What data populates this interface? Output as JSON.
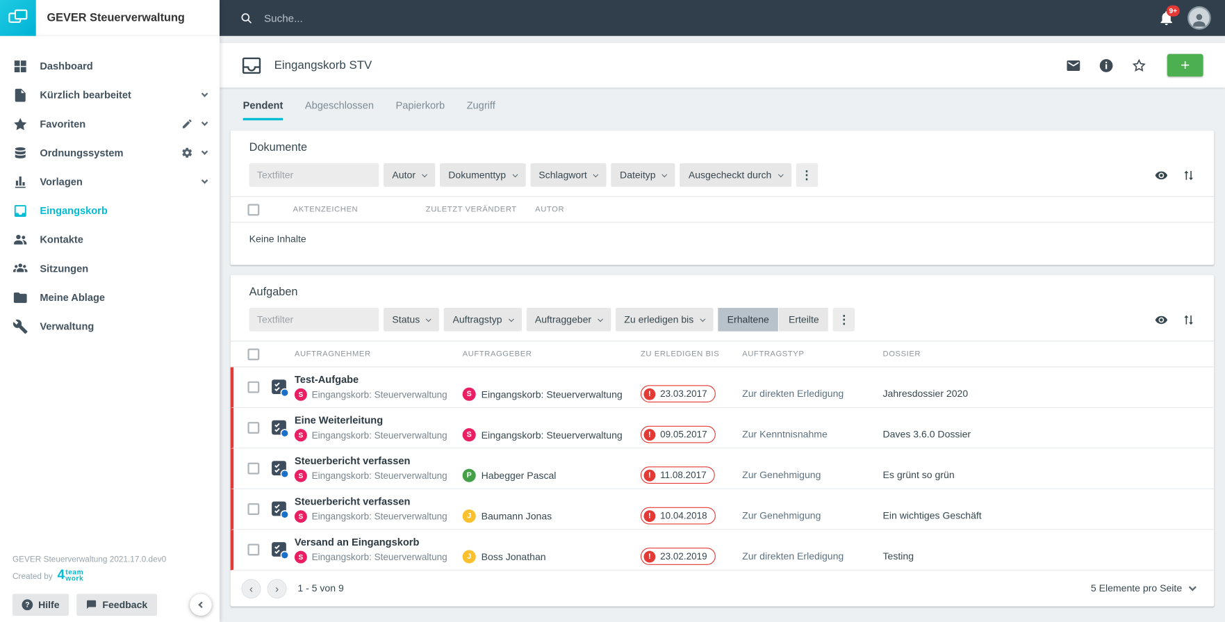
{
  "colors": {
    "accent": "#00bcd4",
    "topbar_bg": "#313e4c",
    "add_button": "#4caf50",
    "danger": "#e53935",
    "task_icon": "#3d4d5d",
    "task_dot": "#1a6fc9"
  },
  "app": {
    "name": "GEVER Steuerverwaltung",
    "version_line": "GEVER Steuerverwaltung 2021.17.0.dev0",
    "created_by_label": "Created by",
    "brand": {
      "mark": "4",
      "top": "team",
      "bottom": "work"
    }
  },
  "topbar": {
    "search_placeholder": "Suche...",
    "notification_badge": "9+"
  },
  "sidebar": {
    "items": [
      {
        "label": "Dashboard",
        "icon": "dashboard",
        "active": false
      },
      {
        "label": "Kürzlich bearbeitet",
        "icon": "document-edit",
        "chevron": true,
        "active": false
      },
      {
        "label": "Favoriten",
        "icon": "star",
        "edit": true,
        "chevron": true,
        "active": false
      },
      {
        "label": "Ordnungssystem",
        "icon": "layers",
        "gear": true,
        "chevron": true,
        "active": false
      },
      {
        "label": "Vorlagen",
        "icon": "templates",
        "chevron": true,
        "active": false
      },
      {
        "label": "Eingangskorb",
        "icon": "inbox",
        "active": true
      },
      {
        "label": "Kontakte",
        "icon": "contacts",
        "active": false
      },
      {
        "label": "Sitzungen",
        "icon": "meetings",
        "active": false
      },
      {
        "label": "Meine Ablage",
        "icon": "folder-user",
        "active": false
      },
      {
        "label": "Verwaltung",
        "icon": "wrench",
        "active": false
      }
    ],
    "help_label": "Hilfe",
    "feedback_label": "Feedback"
  },
  "header": {
    "title": "Eingangskorb STV",
    "add_label": "+"
  },
  "tabs": [
    {
      "label": "Pendent",
      "active": true
    },
    {
      "label": "Abgeschlossen",
      "active": false
    },
    {
      "label": "Papierkorb",
      "active": false
    },
    {
      "label": "Zugriff",
      "active": false
    }
  ],
  "dokumente": {
    "title": "Dokumente",
    "textfilter_placeholder": "Textfilter",
    "filters": [
      "Autor",
      "Dokumenttyp",
      "Schlagwort",
      "Dateityp",
      "Ausgecheckt durch"
    ],
    "columns": [
      "AKTENZEICHEN",
      "ZULETZT VERÄNDERT",
      "AUTOR"
    ],
    "empty_label": "Keine Inhalte"
  },
  "aufgaben": {
    "title": "Aufgaben",
    "textfilter_placeholder": "Textfilter",
    "filters": [
      "Status",
      "Auftragstyp",
      "Auftraggeber",
      "Zu erledigen bis"
    ],
    "toggle": [
      {
        "label": "Erhaltene",
        "active": true
      },
      {
        "label": "Erteilte",
        "active": false
      }
    ],
    "columns": [
      "AUFTRAGNEHMER",
      "AUFTRAGGEBER",
      "ZU ERLEDIGEN BIS",
      "AUFTRAGSTYP",
      "DOSSIER"
    ],
    "rows": [
      {
        "title": "Test-Aufgabe",
        "nehmer": {
          "name": "Eingangskorb: Steuerverwaltung",
          "initial": "S",
          "color": "#e91e63"
        },
        "geber": {
          "name": "Eingangskorb: Steuerverwaltung",
          "initial": "S",
          "color": "#e91e63"
        },
        "due": "23.03.2017",
        "typ": "Zur direkten Erledigung",
        "dossier": "Jahresdossier 2020"
      },
      {
        "title": "Eine Weiterleitung",
        "nehmer": {
          "name": "Eingangskorb: Steuerverwaltung",
          "initial": "S",
          "color": "#e91e63"
        },
        "geber": {
          "name": "Eingangskorb: Steuerverwaltung",
          "initial": "S",
          "color": "#e91e63"
        },
        "due": "09.05.2017",
        "typ": "Zur Kenntnisnahme",
        "dossier": "Daves 3.6.0 Dossier"
      },
      {
        "title": "Steuerbericht verfassen",
        "nehmer": {
          "name": "Eingangskorb: Steuerverwaltung",
          "initial": "S",
          "color": "#e91e63"
        },
        "geber": {
          "name": "Habegger Pascal",
          "initial": "P",
          "color": "#43a047"
        },
        "due": "11.08.2017",
        "typ": "Zur Genehmigung",
        "dossier": "Es grünt so grün"
      },
      {
        "title": "Steuerbericht verfassen",
        "nehmer": {
          "name": "Eingangskorb: Steuerverwaltung",
          "initial": "S",
          "color": "#e91e63"
        },
        "geber": {
          "name": "Baumann Jonas",
          "initial": "J",
          "color": "#fbc02d"
        },
        "due": "10.04.2018",
        "typ": "Zur Genehmigung",
        "dossier": "Ein wichtiges Geschäft"
      },
      {
        "title": "Versand an Eingangskorb",
        "nehmer": {
          "name": "Eingangskorb: Steuerverwaltung",
          "initial": "S",
          "color": "#e91e63"
        },
        "geber": {
          "name": "Boss Jonathan",
          "initial": "J",
          "color": "#fbc02d"
        },
        "due": "23.02.2019",
        "typ": "Zur direkten Erledigung",
        "dossier": "Testing"
      }
    ],
    "pagination": {
      "range_label": "1 - 5 von 9",
      "per_page_label": "5 Elemente pro Seite"
    }
  },
  "icons_text": {
    "more_menu": "⋮",
    "overdue_mark": "!",
    "help_mark": "?",
    "pager_prev": "‹",
    "pager_next": "›"
  }
}
